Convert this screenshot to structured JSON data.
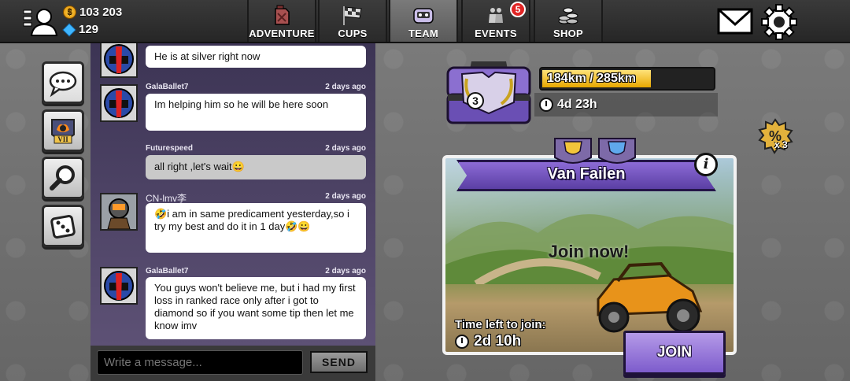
{
  "header": {
    "coins": "103 203",
    "gems": "129",
    "tabs": [
      {
        "label": "ADVENTURE",
        "icon": "jerrycan-icon",
        "active": false
      },
      {
        "label": "CUPS",
        "icon": "checkered-flag-icon",
        "active": false
      },
      {
        "label": "TEAM",
        "icon": "team-helmet-icon",
        "active": true
      },
      {
        "label": "EVENTS",
        "icon": "events-people-icon",
        "active": false,
        "badge": "5"
      },
      {
        "label": "SHOP",
        "icon": "coin-stack-icon",
        "active": false
      }
    ]
  },
  "sidebar": {
    "items": [
      {
        "name": "chat",
        "icon": "chat-bubbles-icon",
        "selected": true
      },
      {
        "name": "team-league",
        "icon": "team-emblem-icon",
        "label": "VII"
      },
      {
        "name": "search",
        "icon": "magnifier-icon"
      },
      {
        "name": "team-management",
        "icon": "team-dice-icon"
      }
    ]
  },
  "chat": {
    "messages": [
      {
        "sender": "",
        "time": "",
        "text": "He is at silver right now"
      },
      {
        "sender": "GalaBallet7",
        "time": "2 days ago",
        "text": "Im helping him so he will be here soon"
      },
      {
        "sender": "Futurespeed",
        "time": "2 days ago",
        "text": "all right ,let's wait😀"
      },
      {
        "sender": "CN-lmv李",
        "time": "2 days ago",
        "text": "🤣i am in same predicament yesterday,so i try my best and do it in 1 day🤣😀"
      },
      {
        "sender": "GalaBallet7",
        "time": "2 days ago",
        "text": "You guys won't believe me, but i had my first loss in ranked race only after i got to diamond so if you want some tip then let me know imv"
      }
    ],
    "input_placeholder": "Write a message...",
    "send_label": "SEND"
  },
  "team_chest": {
    "level": "3",
    "progress_text": "184km / 285km",
    "progress_fraction": 0.646,
    "timer": "4d 23h"
  },
  "boost": {
    "multiplier": "x 3"
  },
  "event": {
    "title": "Van Failen",
    "cta_overlay": "Join now!",
    "time_left_label": "Time left to join:",
    "time_left": "2d 10h",
    "join_label": "JOIN"
  },
  "colors": {
    "accent_purple": "#7d5ccc",
    "chat_bg": "#4a405f",
    "badge_red": "#e02525"
  }
}
